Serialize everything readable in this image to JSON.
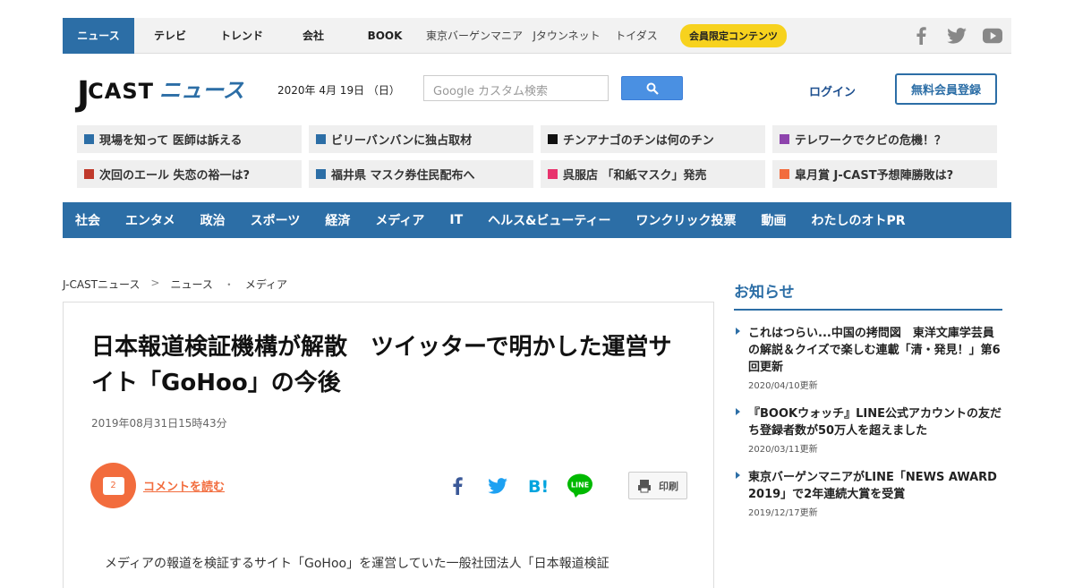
{
  "topnav": {
    "items": [
      {
        "label": "ニュース",
        "active": true
      },
      {
        "label": "テレビ",
        "active": false
      },
      {
        "label": "トレンド",
        "active": false
      },
      {
        "label": "会社",
        "active": false
      },
      {
        "label": "BOOK",
        "active": false
      },
      {
        "label": "東京バーゲンマニア",
        "active": false
      },
      {
        "label": "Jタウンネット",
        "active": false
      },
      {
        "label": "トイダス",
        "active": false
      }
    ],
    "member_pill": "会員限定コンテンツ",
    "social": [
      "facebook-icon",
      "twitter-icon",
      "youtube-icon"
    ]
  },
  "header": {
    "logo_j": "J",
    "logo_cast": "CAST",
    "logo_news": "ニュース",
    "date": "2020年 4月 19日 （日）",
    "search_placeholder": "Google カスタム検索",
    "login": "ログイン",
    "register": "無料会員登録"
  },
  "pickups": [
    {
      "label": "現場を知って 医師は訴える",
      "color": "#2c6ea6"
    },
    {
      "label": "ビリーバンバンに独占取材",
      "color": "#2c6ea6"
    },
    {
      "label": "チンアナゴのチンは何のチン",
      "color": "#111111"
    },
    {
      "label": "テレワークでクビの危機！？",
      "color": "#8e44ad"
    },
    {
      "label": "次回のエール 失恋の裕一は?",
      "color": "#c0392b"
    },
    {
      "label": "福井県 マスク券住民配布へ",
      "color": "#2c6ea6"
    },
    {
      "label": "呉服店 「和紙マスク」発売",
      "color": "#e8336d"
    },
    {
      "label": "皐月賞 J-CAST予想陣勝敗は?",
      "color": "#f26c3d"
    }
  ],
  "catnav": [
    "社会",
    "エンタメ",
    "政治",
    "スポーツ",
    "経済",
    "メディア",
    "IT",
    "ヘルス&ビューティー",
    "ワンクリック投票",
    "動画",
    "わたしのオトPR"
  ],
  "breadcrumb": [
    "J-CASTニュース",
    "ニュース",
    "メディア"
  ],
  "article": {
    "title": "日本報道検証機構が解散　ツイッターで明かした運営サイト「GoHoo」の今後",
    "published": "2019年08月31日15時43分",
    "comment_count": "2",
    "comment_link": "コメントを読む",
    "print": "印刷",
    "body_start": "メディアの報道を検証するサイト「GoHoo」を運営していた一般社団法人「日本報道検証"
  },
  "sidebar": {
    "title": "お知らせ",
    "notices": [
      {
        "title": "これはつらい...中国の拷問図　東洋文庫学芸員の解説＆クイズで楽しむ連載「清・発見！」第6回更新",
        "date": "2020/04/10更新"
      },
      {
        "title": "『BOOKウォッチ』LINE公式アカウントの友だち登録者数が50万人を超えました",
        "date": "2020/03/11更新"
      },
      {
        "title": "東京バーゲンマニアがLINE「NEWS AWARD 2019」で2年連続大賞を受賞",
        "date": "2019/12/17更新"
      }
    ]
  },
  "colors": {
    "brand": "#2c6ea6",
    "accent": "#f26c3d",
    "pill": "#f7d21e"
  }
}
